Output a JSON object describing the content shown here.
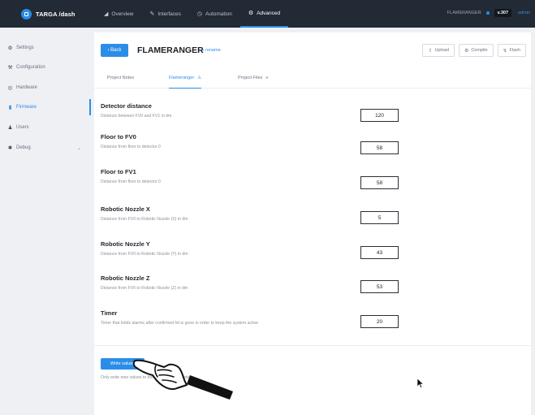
{
  "brand": {
    "name": "TARGA /dash"
  },
  "nav": [
    {
      "icon": "chart-icon",
      "glyph": "◢",
      "label": "Overview"
    },
    {
      "icon": "pencil-icon",
      "glyph": "✎",
      "label": "Interfaces"
    },
    {
      "icon": "clock-icon",
      "glyph": "◷",
      "label": "Automation"
    },
    {
      "icon": "gear-icon",
      "glyph": "⚙",
      "label": "Advanced",
      "active": true
    }
  ],
  "top_right": {
    "device": "FLAMERANGER",
    "version": "v.307",
    "user": "admin"
  },
  "sidebar": {
    "items": [
      {
        "icon": "gear-icon",
        "glyph": "⚙",
        "label": "Settings"
      },
      {
        "icon": "sliders-icon",
        "glyph": "⚒",
        "label": "Configuration"
      },
      {
        "icon": "chip-icon",
        "glyph": "◎",
        "label": "Hardware"
      },
      {
        "icon": "file-icon",
        "glyph": "▮",
        "label": "Firmware",
        "active": true
      },
      {
        "icon": "user-icon",
        "glyph": "♟",
        "label": "Users"
      },
      {
        "icon": "bug-icon",
        "glyph": "✱",
        "label": "Debug",
        "caret": "⌄"
      }
    ]
  },
  "project": {
    "back_label": "‹ Back",
    "title": "FLAMERANGER",
    "rename_label": "✎ rename",
    "actions": [
      {
        "icon": "upload-icon",
        "glyph": "⇪",
        "label": "Upload"
      },
      {
        "icon": "compile-icon",
        "glyph": "⚙",
        "label": "Compile"
      },
      {
        "icon": "flash-icon",
        "glyph": "↯",
        "label": "Flash"
      }
    ]
  },
  "tabs": [
    {
      "label": "Project Notes",
      "icon": ""
    },
    {
      "label": "Flameranger",
      "icon": "⚠",
      "active": true
    },
    {
      "label": "Project Files",
      "icon": "≡"
    }
  ],
  "params": [
    {
      "name": "Detector distance",
      "desc": "Distance between FV0 and FV1 in dm",
      "value": "120"
    },
    {
      "name": "Floor to FV0",
      "desc": "Distance from floor to detector 0",
      "value": "58"
    },
    {
      "name": "Floor to FV1",
      "desc": "Distance from floor to detector 0",
      "value": "58"
    },
    {
      "name": "Robotic Nozzle X",
      "desc": "Distance from FV0 to Robotic Nozzle (X) in dm",
      "value": "5"
    },
    {
      "name": "Robotic Nozzle Y",
      "desc": "Distance from FV0 to Robotic Nozzle (Y) in dm",
      "value": "43"
    },
    {
      "name": "Robotic Nozzle Z",
      "desc": "Distance from FV0 to Robotic Nozzle (Z) in dm",
      "value": "53"
    },
    {
      "name": "Timer",
      "desc": "Timer that holds alarms after confirmed hit is gone in order to keep the system active",
      "value": "20"
    }
  ],
  "write": {
    "button_label": "Write values",
    "note": "Only write new values to the Flameranger system"
  },
  "colors": {
    "accent": "#2b8de8",
    "topbar": "#222a36",
    "background": "#eef0f4"
  }
}
